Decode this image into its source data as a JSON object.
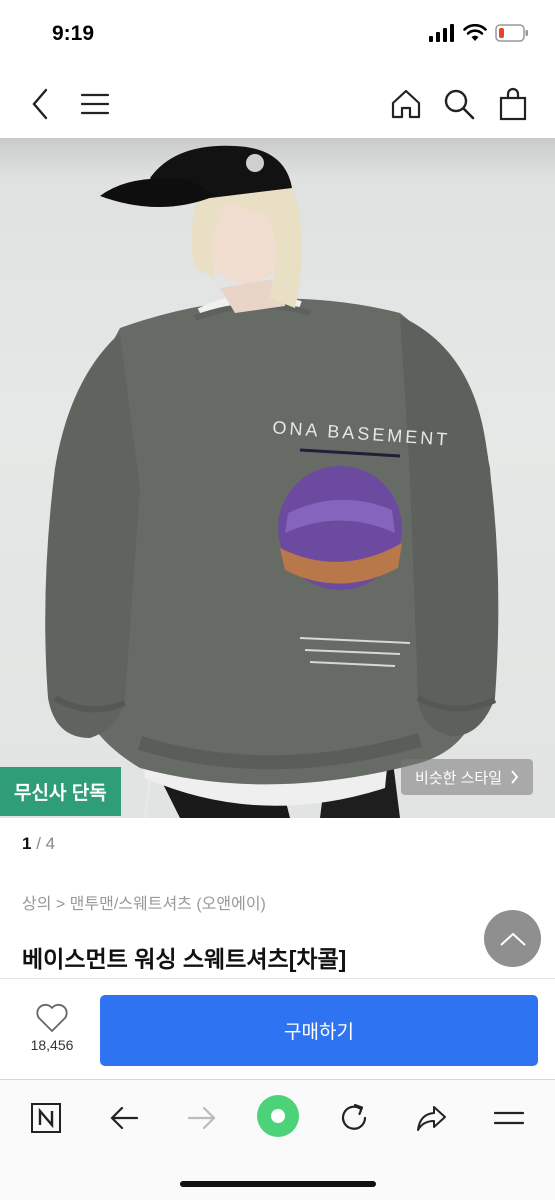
{
  "status_bar": {
    "time": "9:19"
  },
  "icons": {
    "back": "chevron-left-icon",
    "menu": "hamburger-menu-icon",
    "home": "home-icon",
    "search": "search-icon",
    "cart": "shopping-bag-icon",
    "heart": "heart-icon",
    "scroll_top": "chevron-up-icon",
    "naver": "naver-n-icon",
    "reload": "reload-icon",
    "share": "share-icon"
  },
  "product": {
    "badge": "무신사 단독",
    "similar_style": "비슷한 스타일",
    "image_index": "1",
    "image_total": "4",
    "breadcrumb": "상의 > 맨투맨/스웨트셔츠 (오앤에이)",
    "title": "베이스먼트 워싱 스웨트셔츠[차콜]",
    "shirt_print": "ONA BASEMENT"
  },
  "buy_bar": {
    "like_count": "18,456",
    "buy_label": "구매하기"
  },
  "colors": {
    "accent_blue": "#2e74f2",
    "exclusive_green": "#2f9e78",
    "green_dot": "#4cd37a"
  }
}
